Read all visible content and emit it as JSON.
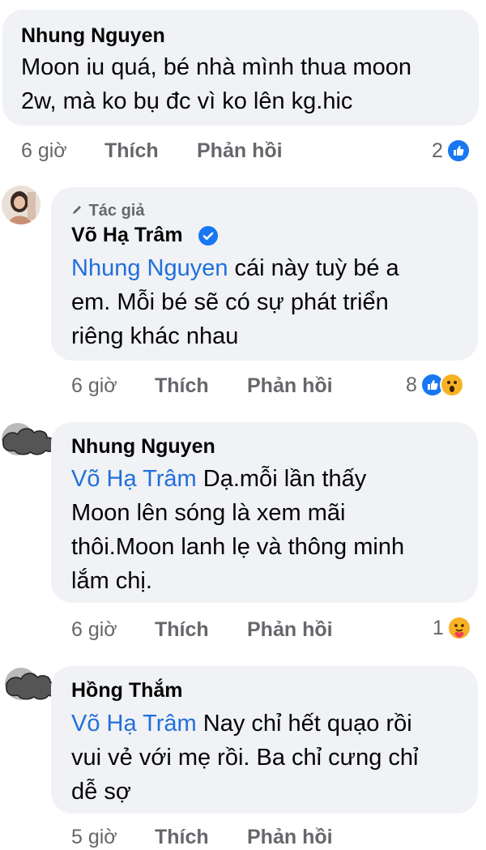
{
  "comments": [
    {
      "author": "Nhung Nguyen",
      "mention": "",
      "text_lines": [
        "Moon iu quá, bé nhà mình thua moon",
        "2w, mà ko bụ đc vì ko lên kg.hic"
      ],
      "time": "6 giờ",
      "like_label": "Thích",
      "reply_label": "Phản hồi",
      "reaction_count": "2",
      "reactions": [
        "like-icon"
      ]
    },
    {
      "badge": "Tác giả",
      "author": "Võ Hạ Trâm",
      "verified": true,
      "mention": "Nhung Nguyen",
      "text_lines": [
        " cái này tuỳ bé a",
        "em. Mỗi bé sẽ có sự phát triển",
        "riêng khác nhau"
      ],
      "time": "6 giờ",
      "like_label": "Thích",
      "reply_label": "Phản hồi",
      "reaction_count": "8",
      "reactions": [
        "like-icon",
        "wow-icon"
      ]
    },
    {
      "author": "Nhung Nguyen",
      "mention": "Võ Hạ Trâm",
      "text_lines": [
        " Dạ.mỗi lần thấy",
        "Moon lên sóng là xem mãi",
        "thôi.Moon lanh lẹ và thông minh",
        "lắm chị."
      ],
      "time": "6 giờ",
      "like_label": "Thích",
      "reply_label": "Phản hồi",
      "reaction_count": "1",
      "reactions": [
        "care-icon"
      ]
    },
    {
      "author": "Hồng Thắm",
      "mention": "Võ Hạ Trâm",
      "text_lines": [
        " Nay chỉ hết quạo rồi",
        "vui vẻ với mẹ rồi. Ba chỉ cưng chỉ",
        "dễ sợ"
      ],
      "time": "5 giờ",
      "like_label": "Thích",
      "reply_label": "Phản hồi"
    }
  ],
  "colors": {
    "bubble": "#f0f2f5",
    "mention": "#216fdb",
    "meta": "#65676b",
    "like": "#1877f2"
  }
}
